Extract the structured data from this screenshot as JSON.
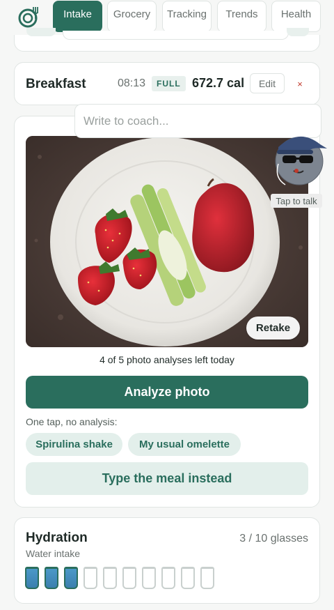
{
  "nav": {
    "tabs": [
      {
        "label": "Intake",
        "active": true
      },
      {
        "label": "Grocery",
        "active": false
      },
      {
        "label": "Tracking",
        "active": false
      },
      {
        "label": "Trends",
        "active": false
      },
      {
        "label": "Health",
        "active": false
      }
    ]
  },
  "meal": {
    "title": "Breakfast",
    "time": "08:13",
    "badge": "FULL",
    "calories": "672.7 cal",
    "edit_label": "Edit",
    "close_label": "×"
  },
  "coach": {
    "placeholder": "Write to coach...",
    "tap_label": "Tap to talk"
  },
  "photo": {
    "retake_label": "Retake",
    "analyses_left": "4 of 5 photo analyses left today",
    "analyze_label": "Analyze photo"
  },
  "quick": {
    "heading": "One tap, no analysis:",
    "chips": [
      "Spirulina shake",
      "My usual omelette"
    ],
    "type_label": "Type the meal instead"
  },
  "hydration": {
    "title": "Hydration",
    "subtitle": "Water intake",
    "count": "3 / 10 glasses",
    "filled": 3,
    "total": 10
  },
  "colors": {
    "accent": "#2a6e5d",
    "accent_light": "#e3efeb",
    "close": "#c0392b",
    "water": "#4b98c8"
  }
}
